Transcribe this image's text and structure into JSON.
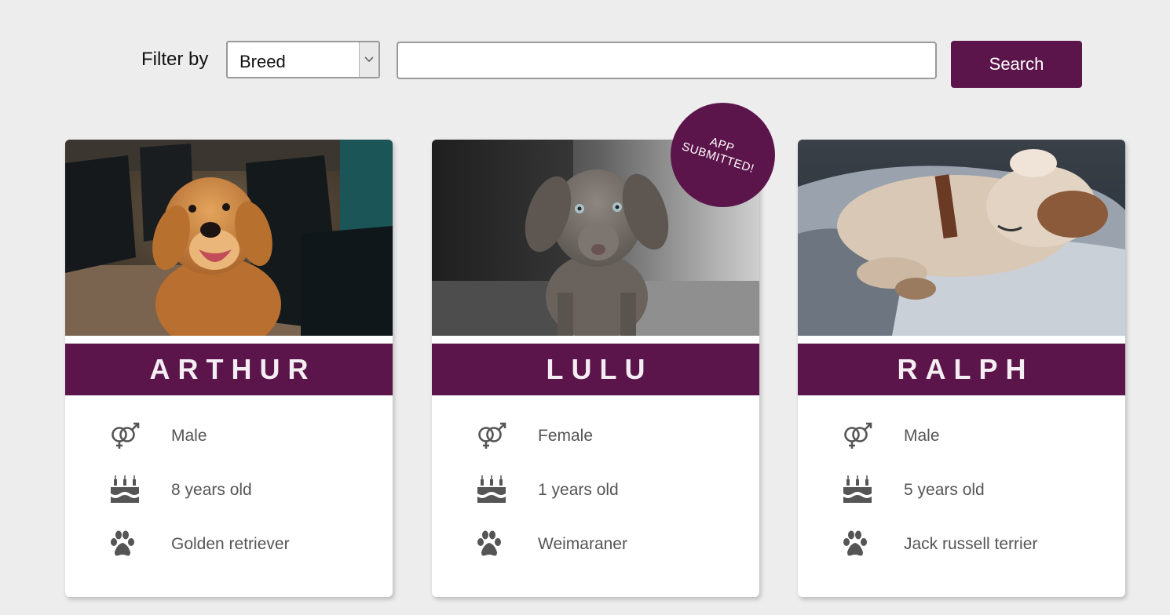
{
  "filter": {
    "label": "Filter by",
    "select_value": "Breed",
    "search_value": "",
    "search_placeholder": "",
    "search_button": "Search"
  },
  "colors": {
    "accent": "#5c154b",
    "background": "#ededed",
    "info_text": "#555555"
  },
  "cards": [
    {
      "name": "ARTHUR",
      "photo": "golden-retriever-photo",
      "gender": "Male",
      "age": "8 years old",
      "breed": "Golden retriever",
      "badge": ""
    },
    {
      "name": "LULU",
      "photo": "weimaraner-puppy-photo",
      "gender": "Female",
      "age": "1 years old",
      "breed": "Weimaraner",
      "badge": "APP SUBMITTED!"
    },
    {
      "name": "RALPH",
      "photo": "jack-russell-sleeping-photo",
      "gender": "Male",
      "age": "5 years old",
      "breed": "Jack russell terrier",
      "badge": ""
    }
  ],
  "icons": {
    "gender": "gender-icon",
    "age": "birthday-cake-icon",
    "breed": "paw-icon",
    "select_arrow": "chevron-down-icon"
  }
}
